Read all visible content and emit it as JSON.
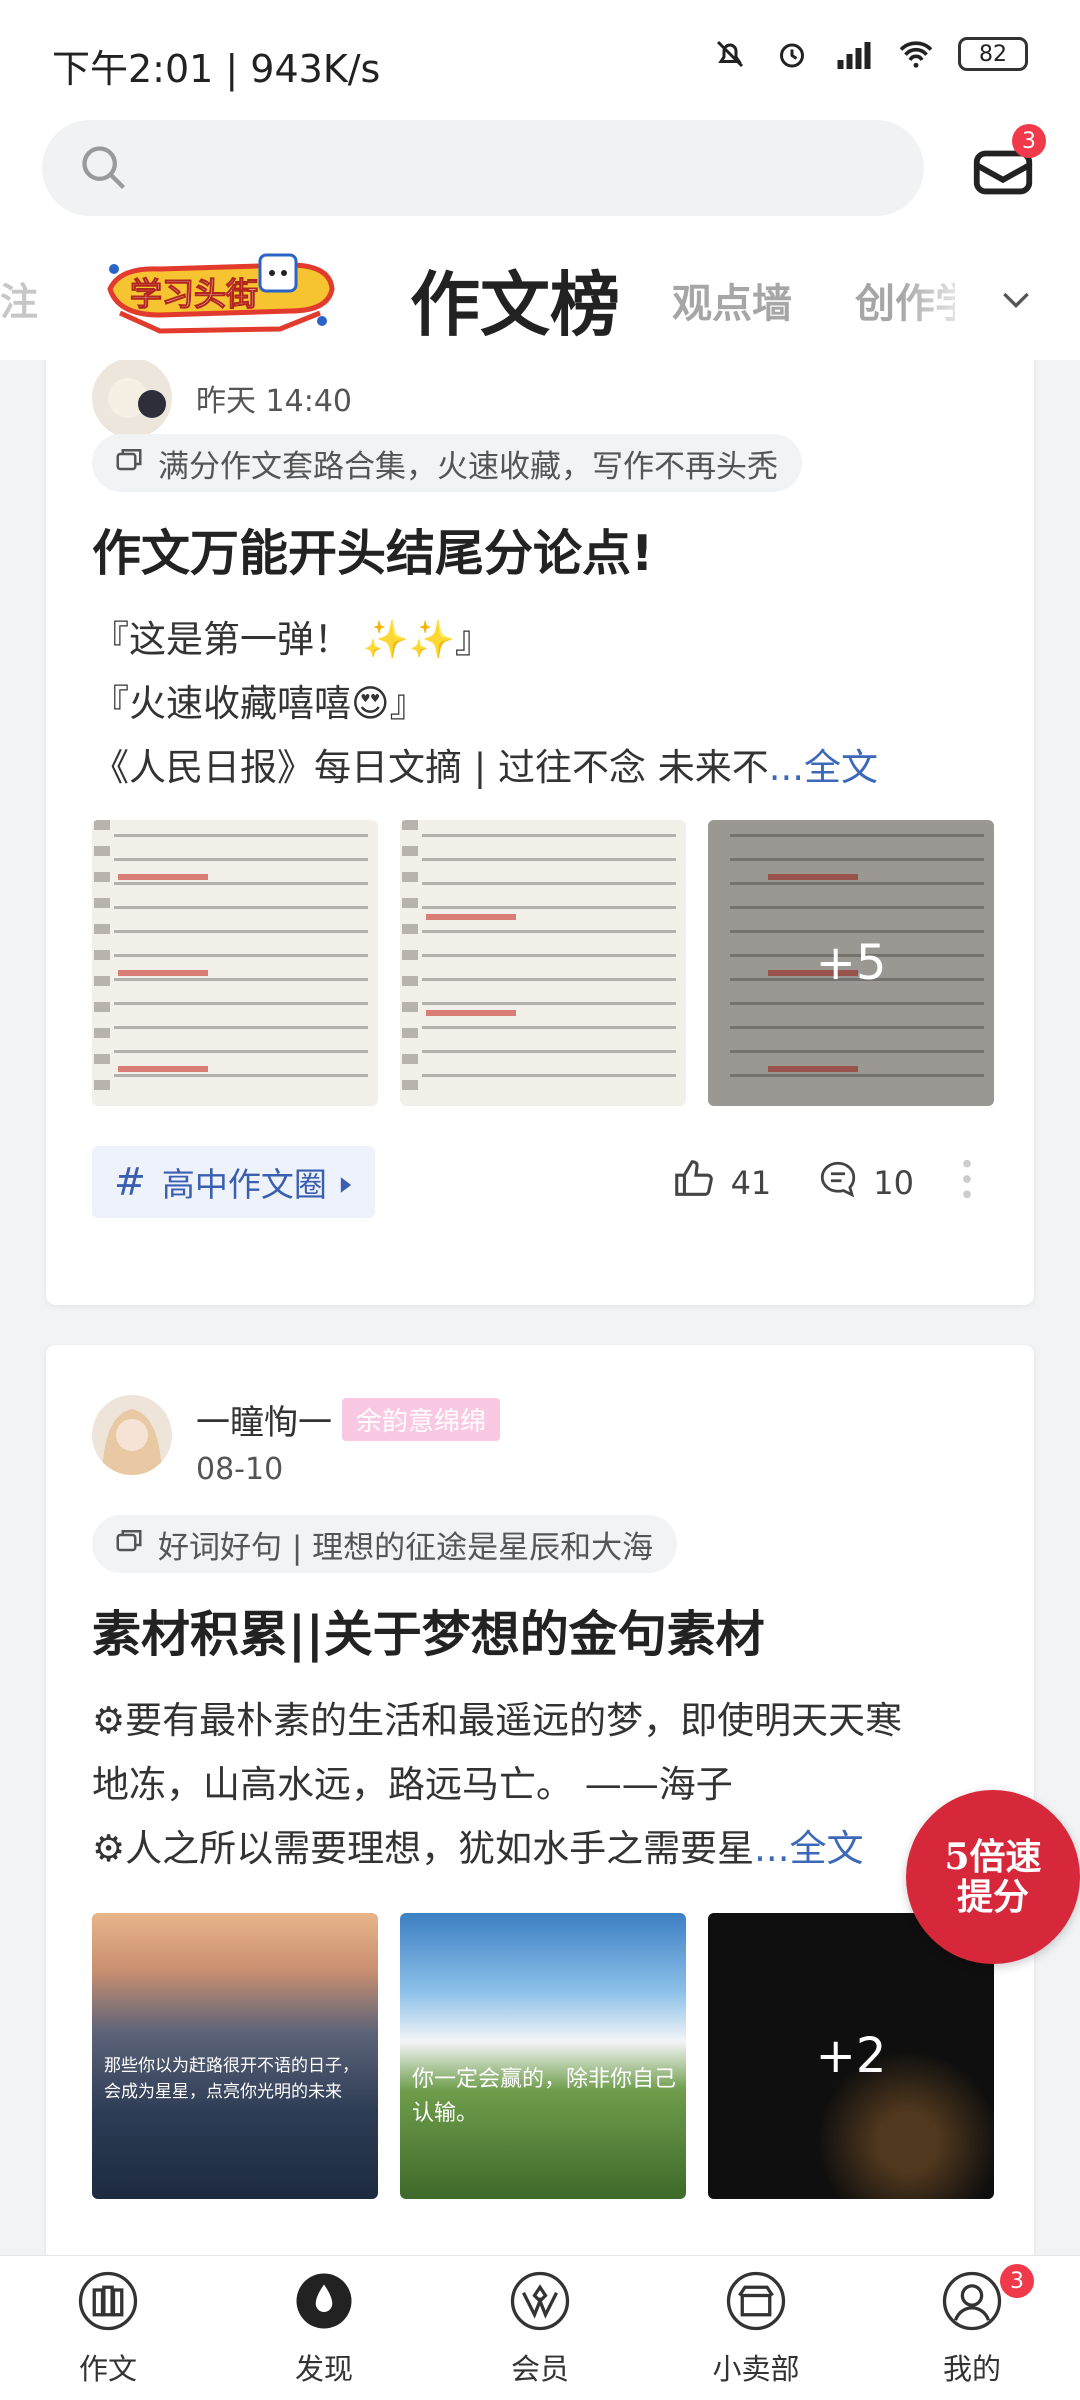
{
  "status_bar": {
    "time": "下午2:01 | 943K/s",
    "battery": "82"
  },
  "header": {
    "mail_badge": "3",
    "tabs": {
      "left_cut": "注",
      "logo_text": "学习头街",
      "active": "作文榜",
      "second": "观点墙",
      "third": "创作学"
    }
  },
  "post1": {
    "time": "昨天 14:40",
    "topic": "满分作文套路合集，火速收藏，写作不再头秃",
    "title": "作文万能开头结尾分论点!",
    "lines": [
      "『这是第一弹！ ✨✨』",
      "『火速收藏嘻嘻😍』"
    ],
    "line3": "《人民日报》每日文摘 | 过往不念 未来不",
    "more": "...全文",
    "more_images": "+5",
    "circle": "高中作文圈",
    "likes": "41",
    "comments": "10"
  },
  "post2": {
    "author": "一瞳恂一",
    "author_tag": "余韵意绵绵",
    "date": "08-10",
    "topic": "好词好句 | 理想的征途是星辰和大海",
    "title": "素材积累||关于梦想的金句素材",
    "line1": "⚙要有最朴素的生活和最遥远的梦，即使明天天寒",
    "line2": "地冻，山高水远，路远马亡。 ——海子",
    "line3": "⚙人之所以需要理想，犹如水手之需要星",
    "more": "...全文",
    "img1_caption": "那些你以为赶路很开不语的日子，会成为星星，点亮你光明的未来",
    "img2_caption": "你一定会赢的，除非你自己认输。",
    "more_images": "+2"
  },
  "promo": {
    "line1": "5倍速",
    "line2": "提分"
  },
  "bottom_nav": [
    {
      "label": "作文",
      "icon": "essay-icon"
    },
    {
      "label": "发现",
      "icon": "discover-icon"
    },
    {
      "label": "会员",
      "icon": "member-icon"
    },
    {
      "label": "小卖部",
      "icon": "shop-icon"
    },
    {
      "label": "我的",
      "icon": "profile-icon",
      "badge": "3"
    }
  ],
  "colors": {
    "accent_blue": "#3b68b8",
    "badge_red": "#f0394a",
    "promo_red": "#d6283a",
    "tag_pink": "#f9c9e3"
  }
}
